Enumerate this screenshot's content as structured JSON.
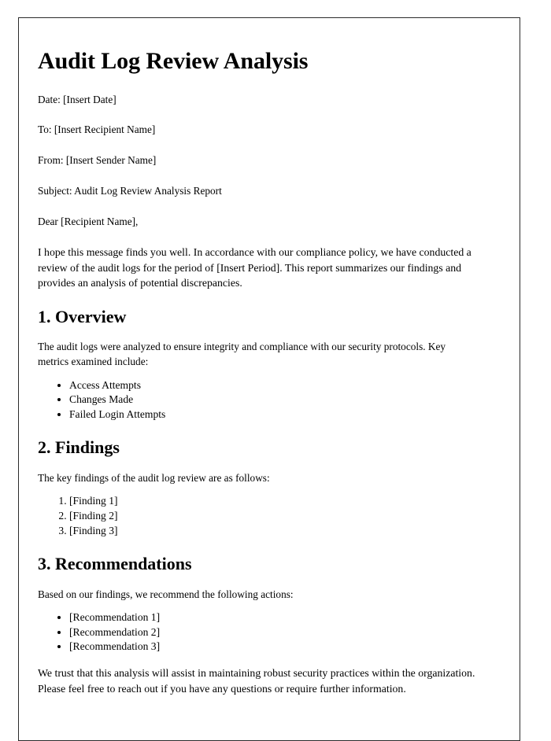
{
  "document": {
    "title": "Audit Log Review Analysis",
    "meta": [
      "Date: [Insert Date]",
      "To: [Insert Recipient Name]",
      "From: [Insert Sender Name]",
      "Subject: Audit Log Review Analysis Report"
    ],
    "salutation": "Dear [Recipient Name],",
    "intro": "I hope this message finds you well. In accordance with our compliance policy, we have conducted a review of the audit logs for the period of [Insert Period]. This report summarizes our findings and provides an analysis of potential discrepancies.",
    "sections": [
      {
        "heading": "1. Overview",
        "paragraph": "The audit logs were analyzed to ensure integrity and compliance with our security protocols. Key metrics examined include:",
        "list_type": "bullet",
        "items": [
          "Access Attempts",
          "Changes Made",
          "Failed Login Attempts"
        ]
      },
      {
        "heading": "2. Findings",
        "paragraph": "The key findings of the audit log review are as follows:",
        "list_type": "number",
        "items": [
          "[Finding 1]",
          "[Finding 2]",
          "[Finding 3]"
        ]
      },
      {
        "heading": "3. Recommendations",
        "paragraph": "Based on our findings, we recommend the following actions:",
        "list_type": "bullet",
        "items": [
          "[Recommendation 1]",
          "[Recommendation 2]",
          "[Recommendation 3]"
        ]
      }
    ],
    "closing": "We trust that this analysis will assist in maintaining robust security practices within the organization. Please feel free to reach out if you have any questions or require further information."
  }
}
